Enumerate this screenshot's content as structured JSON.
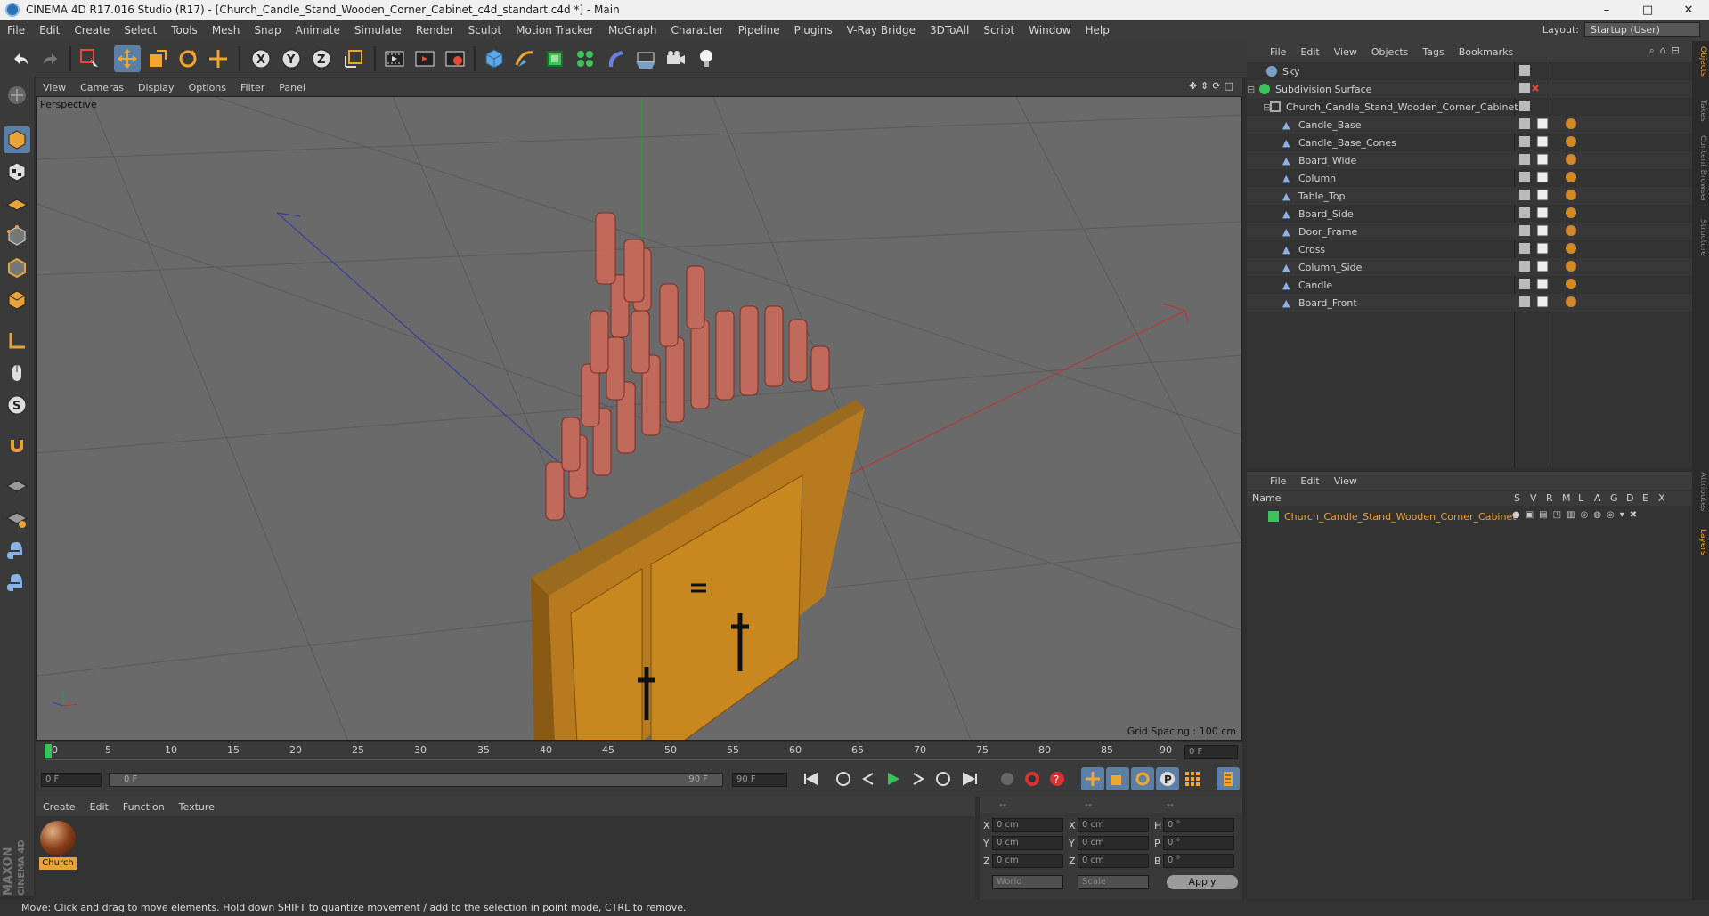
{
  "window": {
    "title": "CINEMA 4D R17.016 Studio (R17) - [Church_Candle_Stand_Wooden_Corner_Cabinet_c4d_standart.c4d *] - Main",
    "minimize": "–",
    "maximize": "□",
    "close": "✕"
  },
  "menu": {
    "items": [
      "File",
      "Edit",
      "Create",
      "Select",
      "Tools",
      "Mesh",
      "Snap",
      "Animate",
      "Simulate",
      "Render",
      "Sculpt",
      "Motion Tracker",
      "MoGraph",
      "Character",
      "Pipeline",
      "Plugins",
      "V-Ray Bridge",
      "3DToAll",
      "Script",
      "Window",
      "Help"
    ],
    "layout_label": "Layout:",
    "layout_value": "Startup (User)"
  },
  "viewport": {
    "menu": [
      "View",
      "Cameras",
      "Display",
      "Options",
      "Filter",
      "Panel"
    ],
    "label": "Perspective",
    "grid_spacing": "Grid Spacing : 100 cm"
  },
  "timeline": {
    "ticks": [
      "0",
      "5",
      "10",
      "15",
      "20",
      "25",
      "30",
      "35",
      "40",
      "45",
      "50",
      "55",
      "60",
      "65",
      "70",
      "75",
      "80",
      "85",
      "90"
    ],
    "frame_field": "0 F",
    "start_field": "0 F",
    "slider_left": "0 F",
    "slider_right": "90 F",
    "end_field": "90 F"
  },
  "material": {
    "menu": [
      "Create",
      "Edit",
      "Function",
      "Texture"
    ],
    "name": "Church"
  },
  "coords": {
    "header": [
      "--",
      "--",
      "--"
    ],
    "rows": [
      {
        "a": "X",
        "av": "0 cm",
        "b": "X",
        "bv": "0 cm",
        "c": "H",
        "cv": "0 °"
      },
      {
        "a": "Y",
        "av": "0 cm",
        "b": "Y",
        "bv": "0 cm",
        "c": "P",
        "cv": "0 °"
      },
      {
        "a": "Z",
        "av": "0 cm",
        "b": "Z",
        "bv": "0 cm",
        "c": "B",
        "cv": "0 °"
      }
    ],
    "world": "World",
    "scale": "Scale",
    "apply": "Apply"
  },
  "objects": {
    "menu": [
      "File",
      "Edit",
      "View",
      "Objects",
      "Tags",
      "Bookmarks"
    ],
    "items": [
      {
        "name": "Sky",
        "indent": 0
      },
      {
        "name": "Subdivision Surface",
        "indent": 0
      },
      {
        "name": "Church_Candle_Stand_Wooden_Corner_Cabinet",
        "indent": 1
      },
      {
        "name": "Candle_Base",
        "indent": 2
      },
      {
        "name": "Candle_Base_Cones",
        "indent": 2
      },
      {
        "name": "Board_Wide",
        "indent": 2
      },
      {
        "name": "Column",
        "indent": 2
      },
      {
        "name": "Table_Top",
        "indent": 2
      },
      {
        "name": "Board_Side",
        "indent": 2
      },
      {
        "name": "Door_Frame",
        "indent": 2
      },
      {
        "name": "Cross",
        "indent": 2
      },
      {
        "name": "Column_Side",
        "indent": 2
      },
      {
        "name": "Candle",
        "indent": 2
      },
      {
        "name": "Board_Front",
        "indent": 2
      }
    ]
  },
  "layers": {
    "menu": [
      "File",
      "Edit",
      "View"
    ],
    "name_header": "Name",
    "cols": [
      "S",
      "V",
      "R",
      "M",
      "L",
      "A",
      "G",
      "D",
      "E",
      "X"
    ],
    "layer_name": "Church_Candle_Stand_Wooden_Corner_Cabinet"
  },
  "right_tabs": [
    "Objects",
    "Takes",
    "Content Browser",
    "Structure",
    "Attributes",
    "Layers"
  ],
  "status": "Move: Click and drag to move elements. Hold down SHIFT to quantize movement / add to the selection in point mode, CTRL to remove.",
  "brand": {
    "maxon": "MAXON",
    "c4d": "CINEMA 4D"
  },
  "colors": {
    "accent": "#5c7fa6",
    "layer_orange": "#e8a33a",
    "layer_green": "#3ec25a",
    "playhead": "#38c35a"
  }
}
